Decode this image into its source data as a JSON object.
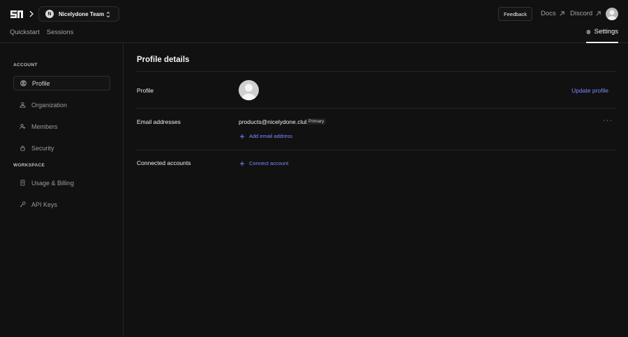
{
  "header": {
    "team_name": "Nicelydone Team",
    "team_initial": "N",
    "tabs": [
      {
        "label": "Quickstart"
      },
      {
        "label": "Sessions"
      }
    ],
    "feedback_label": "Feedback",
    "docs_label": "Docs",
    "discord_label": "Discord",
    "settings_label": "Settings"
  },
  "sidebar": {
    "account_label": "ACCOUNT",
    "workspace_label": "WORKSPACE",
    "account_items": [
      {
        "label": "Profile",
        "icon": "user-circle-icon"
      },
      {
        "label": "Organization",
        "icon": "organization-icon"
      },
      {
        "label": "Members",
        "icon": "members-icon"
      },
      {
        "label": "Security",
        "icon": "lock-icon"
      }
    ],
    "workspace_items": [
      {
        "label": "Usage & Billing",
        "icon": "receipt-icon"
      },
      {
        "label": "API Keys",
        "icon": "key-icon"
      }
    ]
  },
  "main": {
    "title": "Profile details",
    "profile_label": "Profile",
    "update_profile_label": "Update profile",
    "email_label": "Email addresses",
    "email": "products@nicelydone.club",
    "primary_badge": "Primary",
    "more_label": "···",
    "add_email_label": "Add email address",
    "connected_label": "Connected accounts",
    "connect_account_label": "Connect account"
  },
  "colors": {
    "background": "#111111",
    "accent_link": "#7b8cff",
    "border": "#262626"
  }
}
